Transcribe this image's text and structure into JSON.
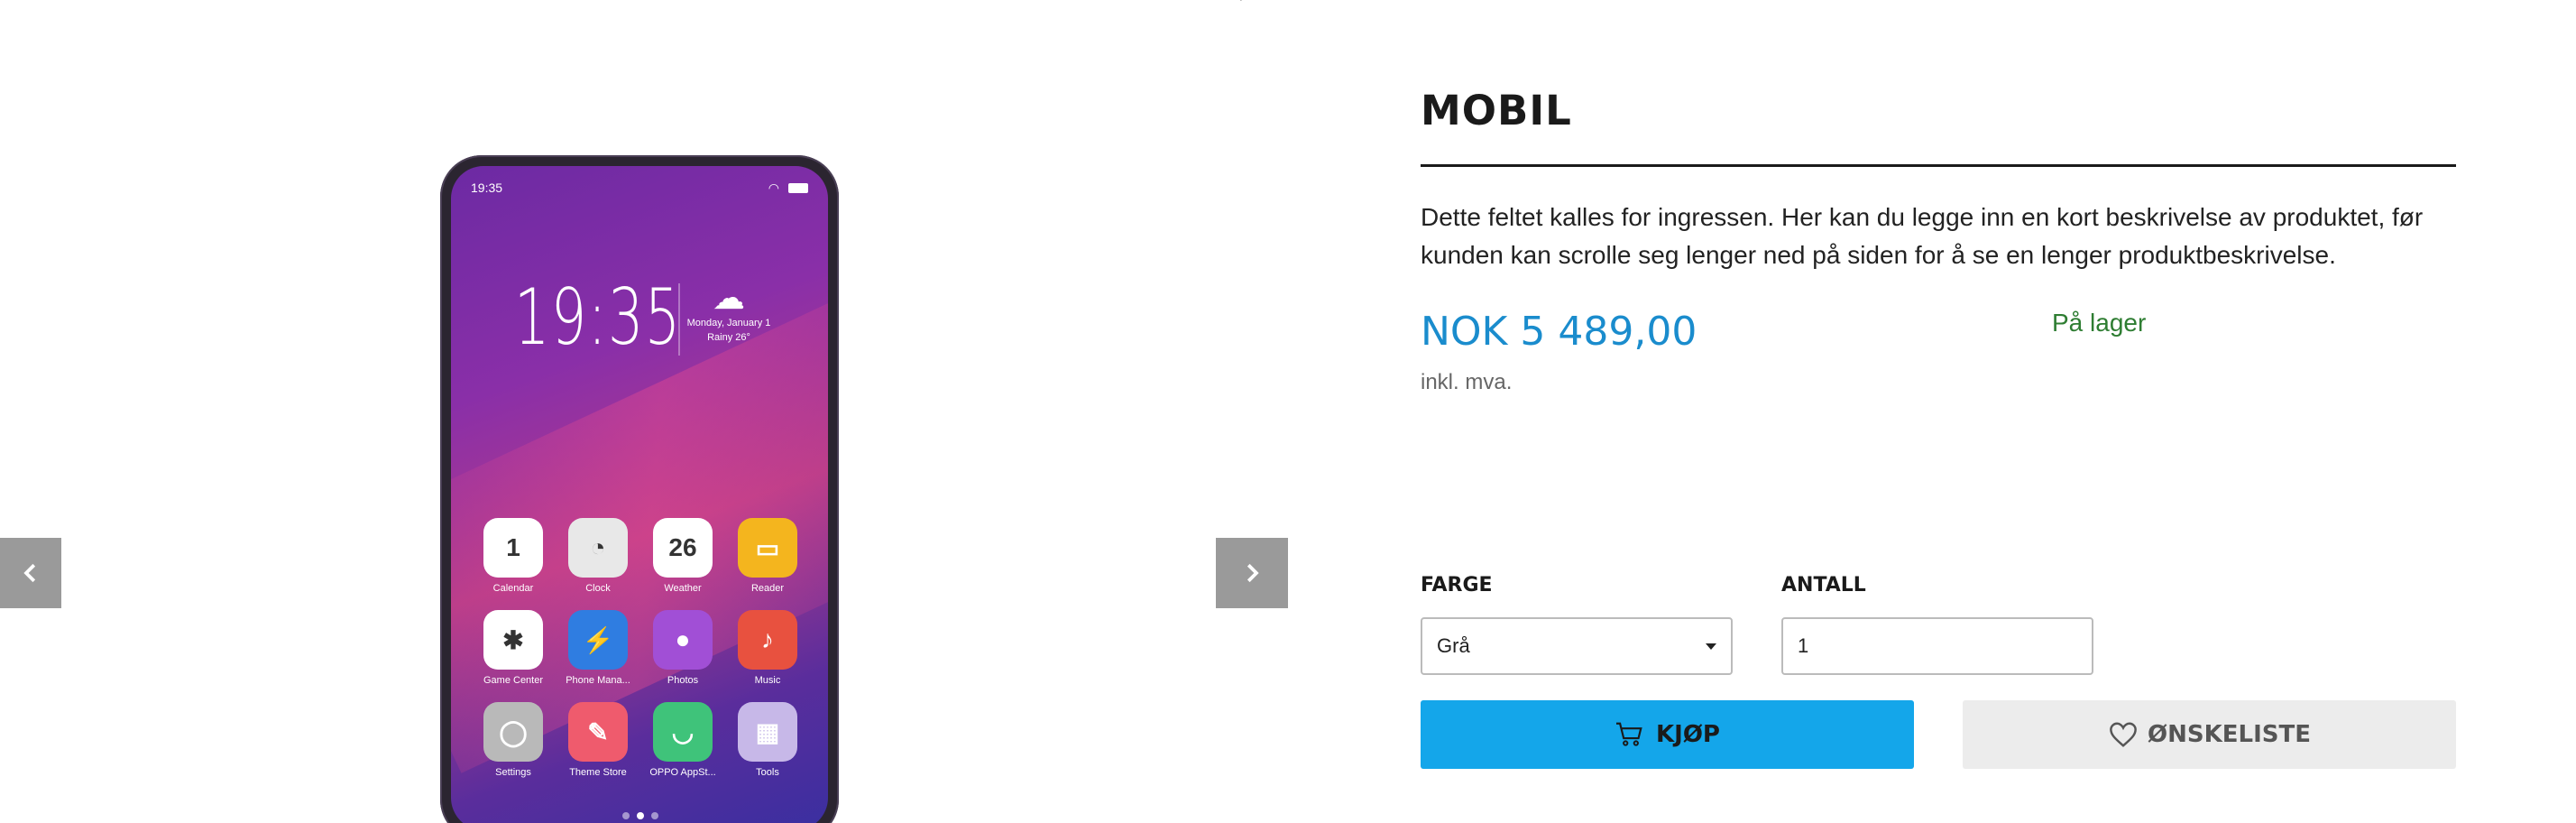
{
  "product": {
    "title": "MOBIL",
    "ingress": "Dette feltet kalles for ingressen. Her kan du legge inn en kort beskrivelse av produktet, før kunden kan scrolle seg lenger ned på siden for å se en lenger produktbeskrivelse.",
    "price": "NOK 5 489,00",
    "vat_note": "inkl. mva.",
    "stock_status": "På lager"
  },
  "options": {
    "color_label": "FARGE",
    "color_value": "Grå",
    "quantity_label": "ANTALL",
    "quantity_value": "1"
  },
  "actions": {
    "buy_label": "KJØP",
    "wishlist_label": "ØNSKELISTE"
  },
  "phone_screen": {
    "status_time": "19:35",
    "clock": "19:35",
    "weather_date": "Monday, January 1",
    "weather_condition": "Rainy 26°",
    "apps": [
      {
        "label": "Calendar",
        "glyph": "1",
        "color": "#ffffff"
      },
      {
        "label": "Clock",
        "glyph": "◔",
        "color": "#e8e8e8"
      },
      {
        "label": "Weather",
        "glyph": "26",
        "color": "#ffffff"
      },
      {
        "label": "Reader",
        "glyph": "▭",
        "color": "#f4b51e"
      },
      {
        "label": "Game Center",
        "glyph": "✱",
        "color": "#ffffff"
      },
      {
        "label": "Phone Mana...",
        "glyph": "⚡",
        "color": "#2f7de1"
      },
      {
        "label": "Photos",
        "glyph": "●",
        "color": "#a14fd6"
      },
      {
        "label": "Music",
        "glyph": "♪",
        "color": "#e8513f"
      },
      {
        "label": "Settings",
        "glyph": "◯",
        "color": "#b9b9b9"
      },
      {
        "label": "Theme Store",
        "glyph": "✎",
        "color": "#ef5b6d"
      },
      {
        "label": "OPPO AppSt...",
        "glyph": "◡",
        "color": "#3fc37a"
      },
      {
        "label": "Tools",
        "glyph": "▦",
        "color": "#c7b8e8"
      }
    ]
  },
  "colors": {
    "accent": "#14a6ea",
    "price": "#1a8ccd",
    "stock": "#2e7d32",
    "arrow_bg": "#9a9a9a"
  }
}
